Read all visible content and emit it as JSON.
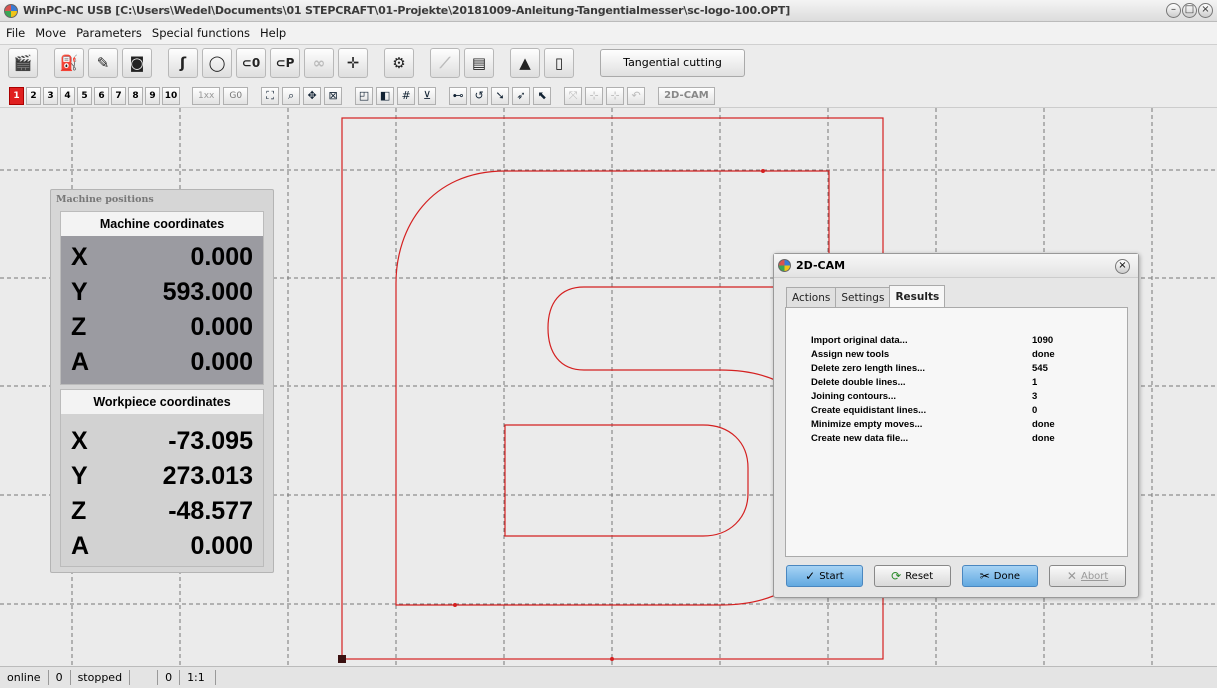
{
  "window": {
    "title": "WinPC-NC USB [C:\\Users\\Wedel\\Documents\\01 STEPCRAFT\\01-Projekte\\20181009-Anleitung-Tangentialmesser\\sc-logo-100.OPT]",
    "controls": [
      "–",
      "□",
      "×"
    ]
  },
  "menu": [
    "File",
    "Move",
    "Parameters",
    "Special functions",
    "Help"
  ],
  "toolbar": {
    "tangential_label": "Tangential cutting",
    "icons": [
      "clapper-icon",
      "basket-icon",
      "pencil-icon",
      "camera-icon",
      "path-icon",
      "rotate-icon",
      "goto-zero-icon",
      "goto-park-icon",
      "binoculars-icon",
      "axes-icon",
      "gears-icon",
      "wrench-icon",
      "calculator-icon",
      "warning-icon",
      "book-icon"
    ],
    "labels": {
      "goto_zero": "⊂0",
      "goto_park": "⊂P"
    }
  },
  "toolbar2": {
    "numbers": [
      "1",
      "2",
      "3",
      "4",
      "5",
      "6",
      "7",
      "8",
      "9",
      "10"
    ],
    "speed1": "1xx",
    "speed2": "G0",
    "cam_label": "2D-CAM"
  },
  "machine_positions": {
    "title": "Machine positions",
    "machine": {
      "header": "Machine coordinates",
      "rows": [
        {
          "axis": "X",
          "value": "0.000"
        },
        {
          "axis": "Y",
          "value": "593.000"
        },
        {
          "axis": "Z",
          "value": "0.000"
        },
        {
          "axis": "A",
          "value": "0.000"
        }
      ]
    },
    "workpiece": {
      "header": "Workpiece coordinates",
      "rows": [
        {
          "axis": "X",
          "value": "-73.095"
        },
        {
          "axis": "Y",
          "value": "273.013"
        },
        {
          "axis": "Z",
          "value": "-48.577"
        },
        {
          "axis": "A",
          "value": "0.000"
        }
      ]
    }
  },
  "cam_dialog": {
    "title": "2D-CAM",
    "tabs": [
      "Actions",
      "Settings",
      "Results"
    ],
    "active_tab": "Results",
    "results": [
      {
        "label": "Import original data...",
        "value": "1090"
      },
      {
        "label": "Assign new tools",
        "value": "done"
      },
      {
        "label": "Delete zero length lines...",
        "value": "545"
      },
      {
        "label": "Delete double lines...",
        "value": "1"
      },
      {
        "label": "Joining contours...",
        "value": "3"
      },
      {
        "label": "Create equidistant lines...",
        "value": "0"
      },
      {
        "label": "Minimize empty moves...",
        "value": "done"
      },
      {
        "label": "Create new data file...",
        "value": "done"
      }
    ],
    "buttons": {
      "start": "Start",
      "reset": "Reset",
      "done": "Done",
      "abort": "Abort"
    }
  },
  "status": {
    "state": "online",
    "count": "0",
    "run_state": "stopped",
    "value": "0",
    "scale": "1:1"
  },
  "colors": {
    "contour": "#d42020",
    "grid": "#777777",
    "active_button": "#e02020",
    "primary_button": "#62a9e0"
  }
}
